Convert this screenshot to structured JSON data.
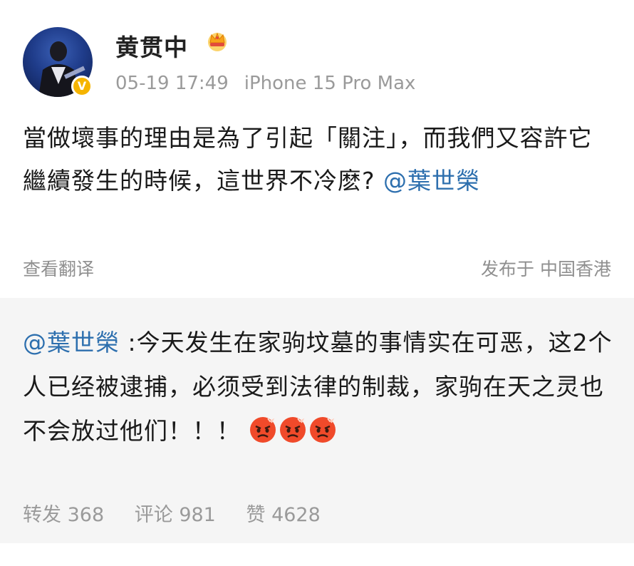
{
  "post": {
    "username": "黄贯中",
    "crown_icon": "crown-icon",
    "verified_icon": "v-badge-icon",
    "verified_label": "V",
    "timestamp": "05-19 17:49",
    "device": "iPhone 15 Pro Max",
    "content_text": "當做壞事的理由是為了引起「關注」，而我們又容許它繼續發生的時候，這世界不冷麽? ",
    "mention": "@葉世榮",
    "translate_label": "查看翻译",
    "location_label": "发布于 中国香港"
  },
  "retweet": {
    "mention": "@葉世榮",
    "text": " :今天发生在家驹坟墓的事情实在可恶，这2个人已经被逮捕，必须受到法律的制裁，家驹在天之灵也不会放过他们！！！ ",
    "emojis": [
      "angry-face-icon",
      "angry-face-icon",
      "angry-face-icon"
    ],
    "stats": {
      "repost_label": "转发",
      "repost_count": "368",
      "comment_label": "评论",
      "comment_count": "981",
      "like_label": "赞",
      "like_count": "4628"
    }
  },
  "colors": {
    "mention": "#2d6fae",
    "meta_gray": "#9a9a9a",
    "retweet_bg": "#f5f5f5",
    "badge": "#f5b400"
  }
}
